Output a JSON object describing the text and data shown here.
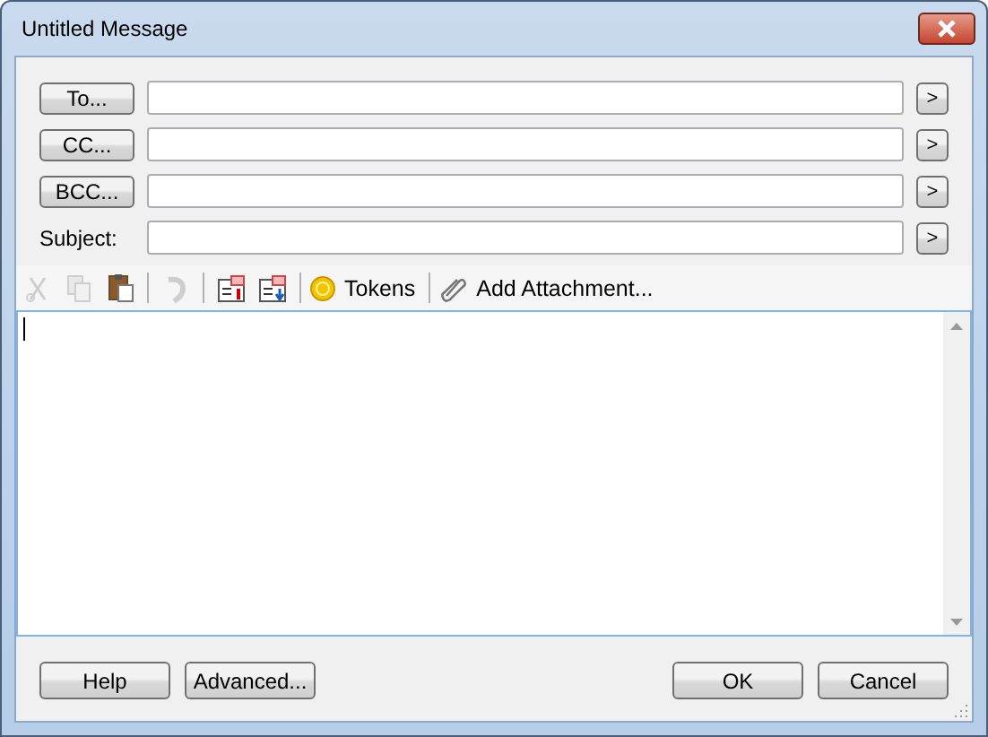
{
  "window": {
    "title": "Untitled Message"
  },
  "fields": [
    {
      "kind": "button",
      "label": "To..."
    },
    {
      "kind": "button",
      "label": "CC..."
    },
    {
      "kind": "button",
      "label": "BCC..."
    },
    {
      "kind": "label",
      "label": "Subject:"
    }
  ],
  "expand_button": ">",
  "toolbar": [
    {
      "kind": "icon",
      "disabled": true
    },
    {
      "kind": "icon",
      "disabled": true
    },
    {
      "kind": "icon",
      "disabled": false
    },
    {
      "kind": "separator"
    },
    {
      "kind": "icon",
      "disabled": true
    },
    {
      "kind": "separator"
    },
    {
      "kind": "icon",
      "disabled": false
    },
    {
      "kind": "icon",
      "disabled": false
    },
    {
      "kind": "separator"
    },
    {
      "kind": "text",
      "label": "Tokens"
    },
    {
      "kind": "separator"
    },
    {
      "kind": "text",
      "label": "Add Attachment..."
    }
  ],
  "buttons_left": [
    "Help",
    "Advanced..."
  ],
  "buttons_right": [
    "OK",
    "Cancel"
  ]
}
